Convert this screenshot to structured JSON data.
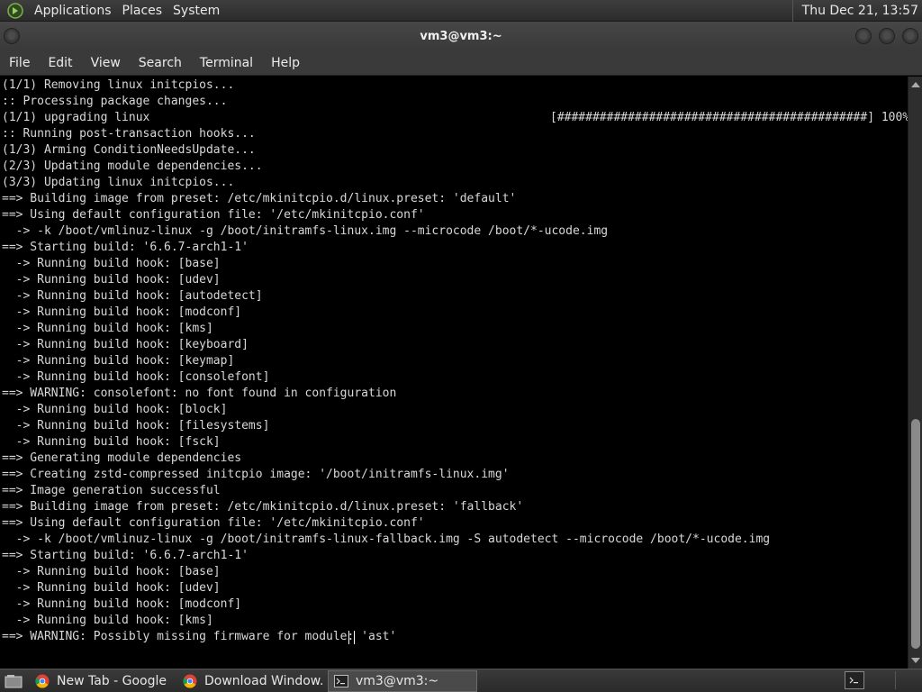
{
  "top_panel": {
    "menus": [
      "Applications",
      "Places",
      "System"
    ],
    "clock": "Thu Dec 21, 13:57"
  },
  "window": {
    "title": "vm3@vm3:~"
  },
  "menubar": [
    "File",
    "Edit",
    "View",
    "Search",
    "Terminal",
    "Help"
  ],
  "terminal": {
    "lines": [
      "(1/1) Removing linux initcpios...",
      ":: Processing package changes...",
      "(1/1) upgrading linux",
      ":: Running post-transaction hooks...",
      "(1/3) Arming ConditionNeedsUpdate...",
      "(2/3) Updating module dependencies...",
      "(3/3) Updating linux initcpios...",
      "==> Building image from preset: /etc/mkinitcpio.d/linux.preset: 'default'",
      "==> Using default configuration file: '/etc/mkinitcpio.conf'",
      "  -> -k /boot/vmlinuz-linux -g /boot/initramfs-linux.img --microcode /boot/*-ucode.img",
      "==> Starting build: '6.6.7-arch1-1'",
      "  -> Running build hook: [base]",
      "  -> Running build hook: [udev]",
      "  -> Running build hook: [autodetect]",
      "  -> Running build hook: [modconf]",
      "  -> Running build hook: [kms]",
      "  -> Running build hook: [keyboard]",
      "  -> Running build hook: [keymap]",
      "  -> Running build hook: [consolefont]",
      "==> WARNING: consolefont: no font found in configuration",
      "  -> Running build hook: [block]",
      "  -> Running build hook: [filesystems]",
      "  -> Running build hook: [fsck]",
      "==> Generating module dependencies",
      "==> Creating zstd-compressed initcpio image: '/boot/initramfs-linux.img'",
      "==> Image generation successful",
      "==> Building image from preset: /etc/mkinitcpio.d/linux.preset: 'fallback'",
      "==> Using default configuration file: '/etc/mkinitcpio.conf'",
      "  -> -k /boot/vmlinuz-linux -g /boot/initramfs-linux-fallback.img -S autodetect --microcode /boot/*-ucode.img",
      "==> Starting build: '6.6.7-arch1-1'",
      "  -> Running build hook: [base]",
      "  -> Running build hook: [udev]",
      "  -> Running build hook: [modconf]",
      "  -> Running build hook: [kms]",
      "==> WARNING: Possibly missing firmware for module: 'ast'"
    ],
    "progress_bar": "[############################################] 100%",
    "progress_percent": 100
  },
  "taskbar": {
    "tasks": [
      {
        "label": "New Tab - Google ...",
        "icon": "chrome-icon",
        "active": false
      },
      {
        "label": "Download Window...",
        "icon": "chrome-icon",
        "active": false
      },
      {
        "label": "vm3@vm3:~",
        "icon": "terminal-icon",
        "active": true
      }
    ]
  },
  "colors": {
    "panel_bg": "#333333",
    "terminal_bg": "#000000",
    "terminal_fg": "#d8d8d8",
    "scrollbar_thumb": "#8a8a8a"
  }
}
